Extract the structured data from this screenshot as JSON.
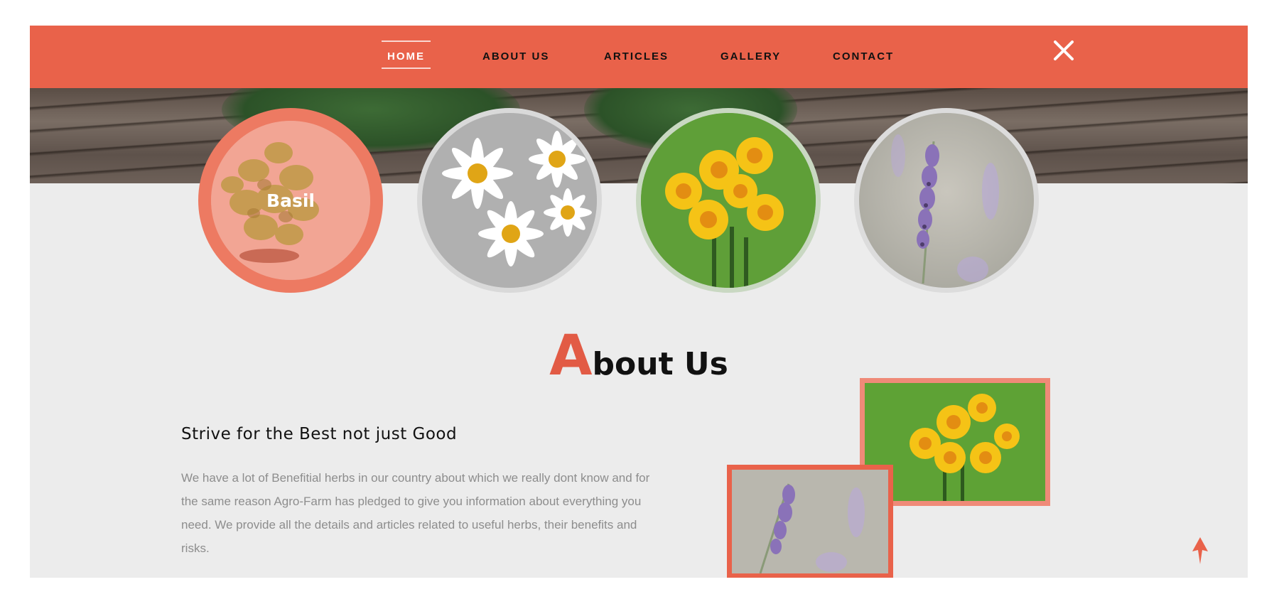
{
  "nav": {
    "items": [
      {
        "label": "HOME",
        "active": true
      },
      {
        "label": "ABOUT US",
        "active": false
      },
      {
        "label": "ARTICLES",
        "active": false
      },
      {
        "label": "GALLERY",
        "active": false
      },
      {
        "label": "CONTACT",
        "active": false
      }
    ],
    "close_icon": "close-icon"
  },
  "circles": [
    {
      "label": "Basil",
      "image": "basil-plant"
    },
    {
      "label": "",
      "image": "white-daisies"
    },
    {
      "label": "",
      "image": "yellow-daffodils"
    },
    {
      "label": "",
      "image": "lavender"
    }
  ],
  "about": {
    "title_initial": "A",
    "title_rest": "bout Us",
    "subtitle": "Strive for the Best not just Good",
    "paragraph": "We have a lot of Benefitial herbs in our country about which we really dont know and for the same reason Agro-Farm has pledged to give you information about everything you need. We provide all the details and articles related to useful herbs, their benefits and risks."
  },
  "colors": {
    "accent": "#e9624a",
    "accent_light": "#ef8a78",
    "background": "#ececec"
  },
  "scroll_top_icon": "arrow-up-icon"
}
